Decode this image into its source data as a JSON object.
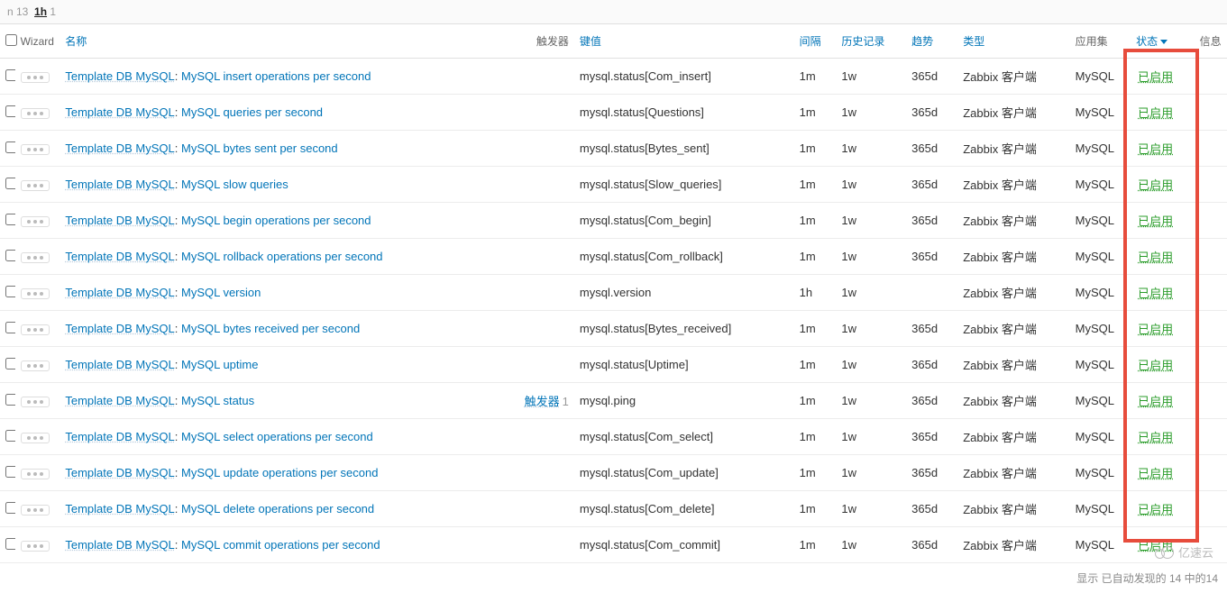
{
  "toolbar": {
    "part1": "n 13",
    "part2": "1h",
    "part3": "1"
  },
  "headers": {
    "wizard": "Wizard",
    "name": "名称",
    "trigger": "触发器",
    "key": "键值",
    "interval": "间隔",
    "history": "历史记录",
    "trend": "趋势",
    "type": "类型",
    "app": "应用集",
    "status": "状态",
    "info": "信息"
  },
  "rows": [
    {
      "tpl": "Template DB MySQL",
      "name": "MySQL insert operations per second",
      "trigger": "",
      "trigger_count": "",
      "key": "mysql.status[Com_insert]",
      "interval": "1m",
      "history": "1w",
      "trend": "365d",
      "type": "Zabbix 客户端",
      "app": "MySQL",
      "status": "已启用"
    },
    {
      "tpl": "Template DB MySQL",
      "name": "MySQL queries per second",
      "trigger": "",
      "trigger_count": "",
      "key": "mysql.status[Questions]",
      "interval": "1m",
      "history": "1w",
      "trend": "365d",
      "type": "Zabbix 客户端",
      "app": "MySQL",
      "status": "已启用"
    },
    {
      "tpl": "Template DB MySQL",
      "name": "MySQL bytes sent per second",
      "trigger": "",
      "trigger_count": "",
      "key": "mysql.status[Bytes_sent]",
      "interval": "1m",
      "history": "1w",
      "trend": "365d",
      "type": "Zabbix 客户端",
      "app": "MySQL",
      "status": "已启用"
    },
    {
      "tpl": "Template DB MySQL",
      "name": "MySQL slow queries",
      "trigger": "",
      "trigger_count": "",
      "key": "mysql.status[Slow_queries]",
      "interval": "1m",
      "history": "1w",
      "trend": "365d",
      "type": "Zabbix 客户端",
      "app": "MySQL",
      "status": "已启用"
    },
    {
      "tpl": "Template DB MySQL",
      "name": "MySQL begin operations per second",
      "trigger": "",
      "trigger_count": "",
      "key": "mysql.status[Com_begin]",
      "interval": "1m",
      "history": "1w",
      "trend": "365d",
      "type": "Zabbix 客户端",
      "app": "MySQL",
      "status": "已启用"
    },
    {
      "tpl": "Template DB MySQL",
      "name": "MySQL rollback operations per second",
      "trigger": "",
      "trigger_count": "",
      "key": "mysql.status[Com_rollback]",
      "interval": "1m",
      "history": "1w",
      "trend": "365d",
      "type": "Zabbix 客户端",
      "app": "MySQL",
      "status": "已启用"
    },
    {
      "tpl": "Template DB MySQL",
      "name": "MySQL version",
      "trigger": "",
      "trigger_count": "",
      "key": "mysql.version",
      "interval": "1h",
      "history": "1w",
      "trend": "",
      "type": "Zabbix 客户端",
      "app": "MySQL",
      "status": "已启用"
    },
    {
      "tpl": "Template DB MySQL",
      "name": "MySQL bytes received per second",
      "trigger": "",
      "trigger_count": "",
      "key": "mysql.status[Bytes_received]",
      "interval": "1m",
      "history": "1w",
      "trend": "365d",
      "type": "Zabbix 客户端",
      "app": "MySQL",
      "status": "已启用"
    },
    {
      "tpl": "Template DB MySQL",
      "name": "MySQL uptime",
      "trigger": "",
      "trigger_count": "",
      "key": "mysql.status[Uptime]",
      "interval": "1m",
      "history": "1w",
      "trend": "365d",
      "type": "Zabbix 客户端",
      "app": "MySQL",
      "status": "已启用"
    },
    {
      "tpl": "Template DB MySQL",
      "name": "MySQL status",
      "trigger": "触发器",
      "trigger_count": "1",
      "key": "mysql.ping",
      "interval": "1m",
      "history": "1w",
      "trend": "365d",
      "type": "Zabbix 客户端",
      "app": "MySQL",
      "status": "已启用"
    },
    {
      "tpl": "Template DB MySQL",
      "name": "MySQL select operations per second",
      "trigger": "",
      "trigger_count": "",
      "key": "mysql.status[Com_select]",
      "interval": "1m",
      "history": "1w",
      "trend": "365d",
      "type": "Zabbix 客户端",
      "app": "MySQL",
      "status": "已启用"
    },
    {
      "tpl": "Template DB MySQL",
      "name": "MySQL update operations per second",
      "trigger": "",
      "trigger_count": "",
      "key": "mysql.status[Com_update]",
      "interval": "1m",
      "history": "1w",
      "trend": "365d",
      "type": "Zabbix 客户端",
      "app": "MySQL",
      "status": "已启用"
    },
    {
      "tpl": "Template DB MySQL",
      "name": "MySQL delete operations per second",
      "trigger": "",
      "trigger_count": "",
      "key": "mysql.status[Com_delete]",
      "interval": "1m",
      "history": "1w",
      "trend": "365d",
      "type": "Zabbix 客户端",
      "app": "MySQL",
      "status": "已启用"
    },
    {
      "tpl": "Template DB MySQL",
      "name": "MySQL commit operations per second",
      "trigger": "",
      "trigger_count": "",
      "key": "mysql.status[Com_commit]",
      "interval": "1m",
      "history": "1w",
      "trend": "365d",
      "type": "Zabbix 客户端",
      "app": "MySQL",
      "status": "已启用"
    }
  ],
  "footer": "显示 已自动发现的 14 中的14",
  "watermark": "亿速云"
}
